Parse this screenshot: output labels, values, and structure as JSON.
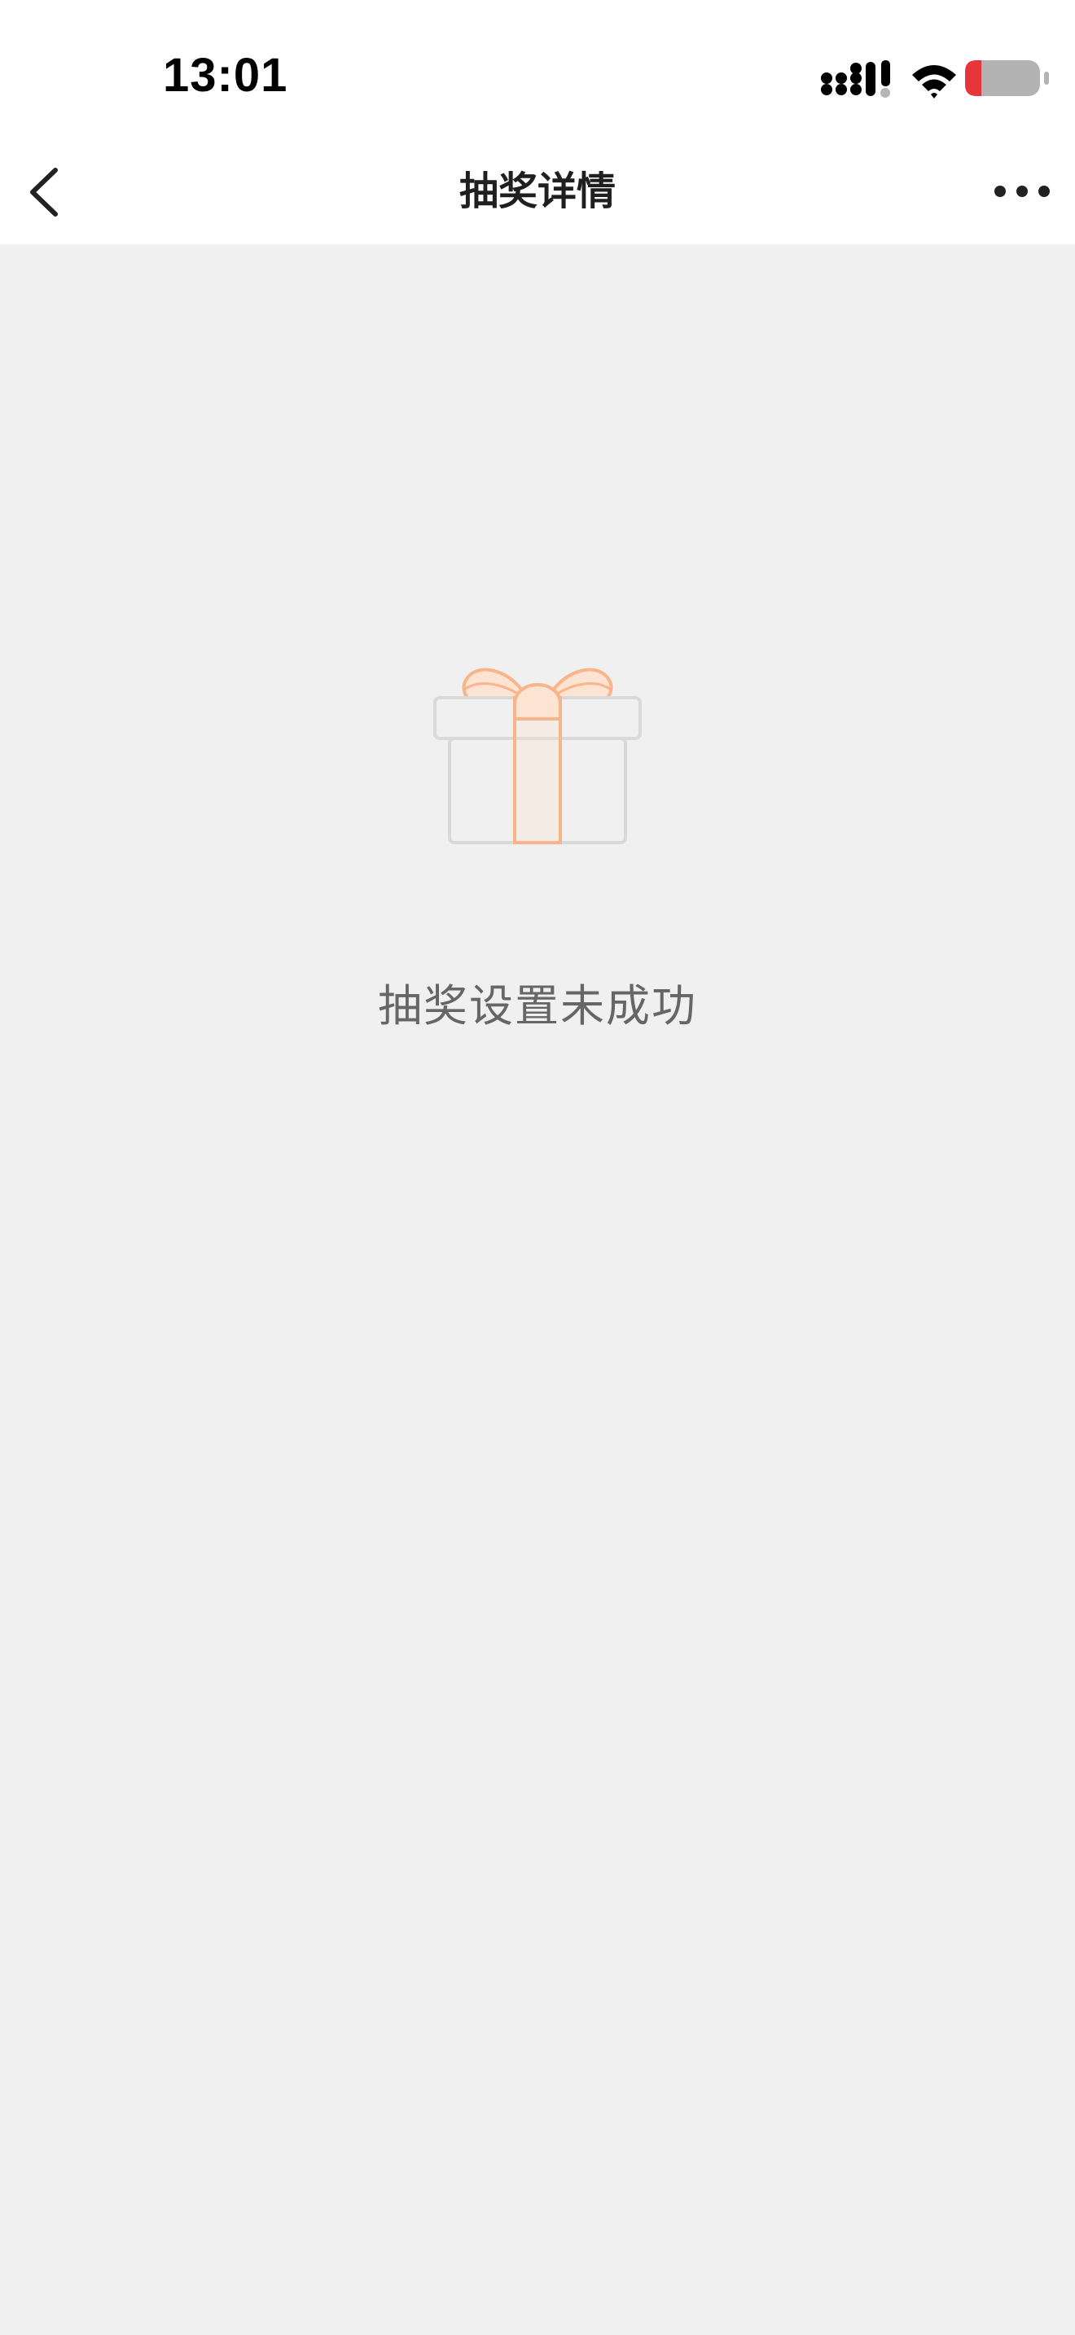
{
  "status_bar": {
    "time": "13:01",
    "icons": [
      "cellular-signal-icon",
      "wifi-icon",
      "battery-low-icon"
    ]
  },
  "nav": {
    "title": "抽奖详情",
    "back_icon": "chevron-left-icon",
    "more_icon": "more-dots-icon"
  },
  "empty_state": {
    "icon": "gift-box-icon",
    "message": "抽奖设置未成功"
  },
  "colors": {
    "background": "#f0f0f0",
    "bar_background": "#ffffff",
    "gift_ribbon": "#f8b48a",
    "gift_ribbon_fill": "#fde3d2",
    "gift_box": "#d9d9d9",
    "battery_low": "#e8343b",
    "message_text": "#666666"
  }
}
